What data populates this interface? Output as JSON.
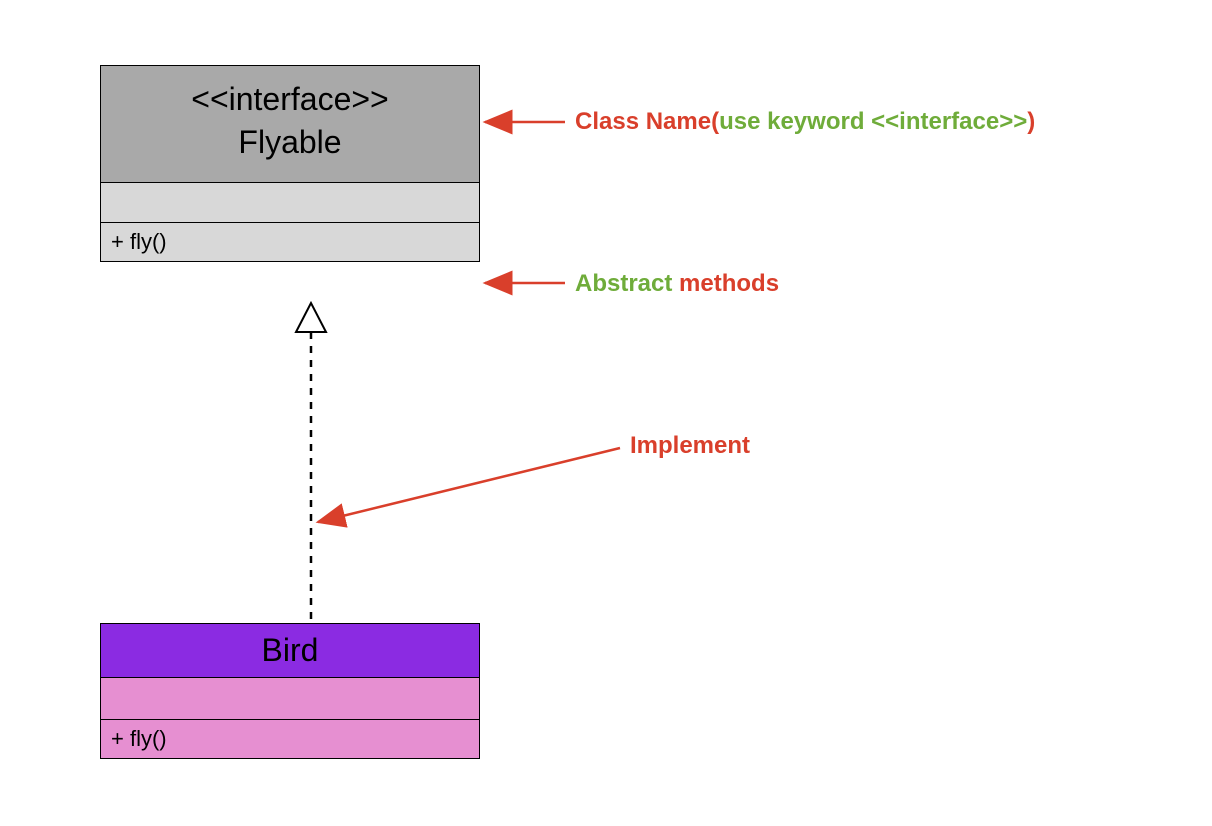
{
  "interface": {
    "stereotype": "<<interface>>",
    "name": "Flyable",
    "method": "+ fly()"
  },
  "bird": {
    "name": "Bird",
    "method": "+ fly()"
  },
  "annotations": {
    "classname_prefix": "Class Name(",
    "classname_keyword": "use keyword <<interface>>",
    "classname_suffix": ")",
    "abstract_word": "Abstract",
    "methods_word": " methods",
    "implement": "Implement"
  }
}
